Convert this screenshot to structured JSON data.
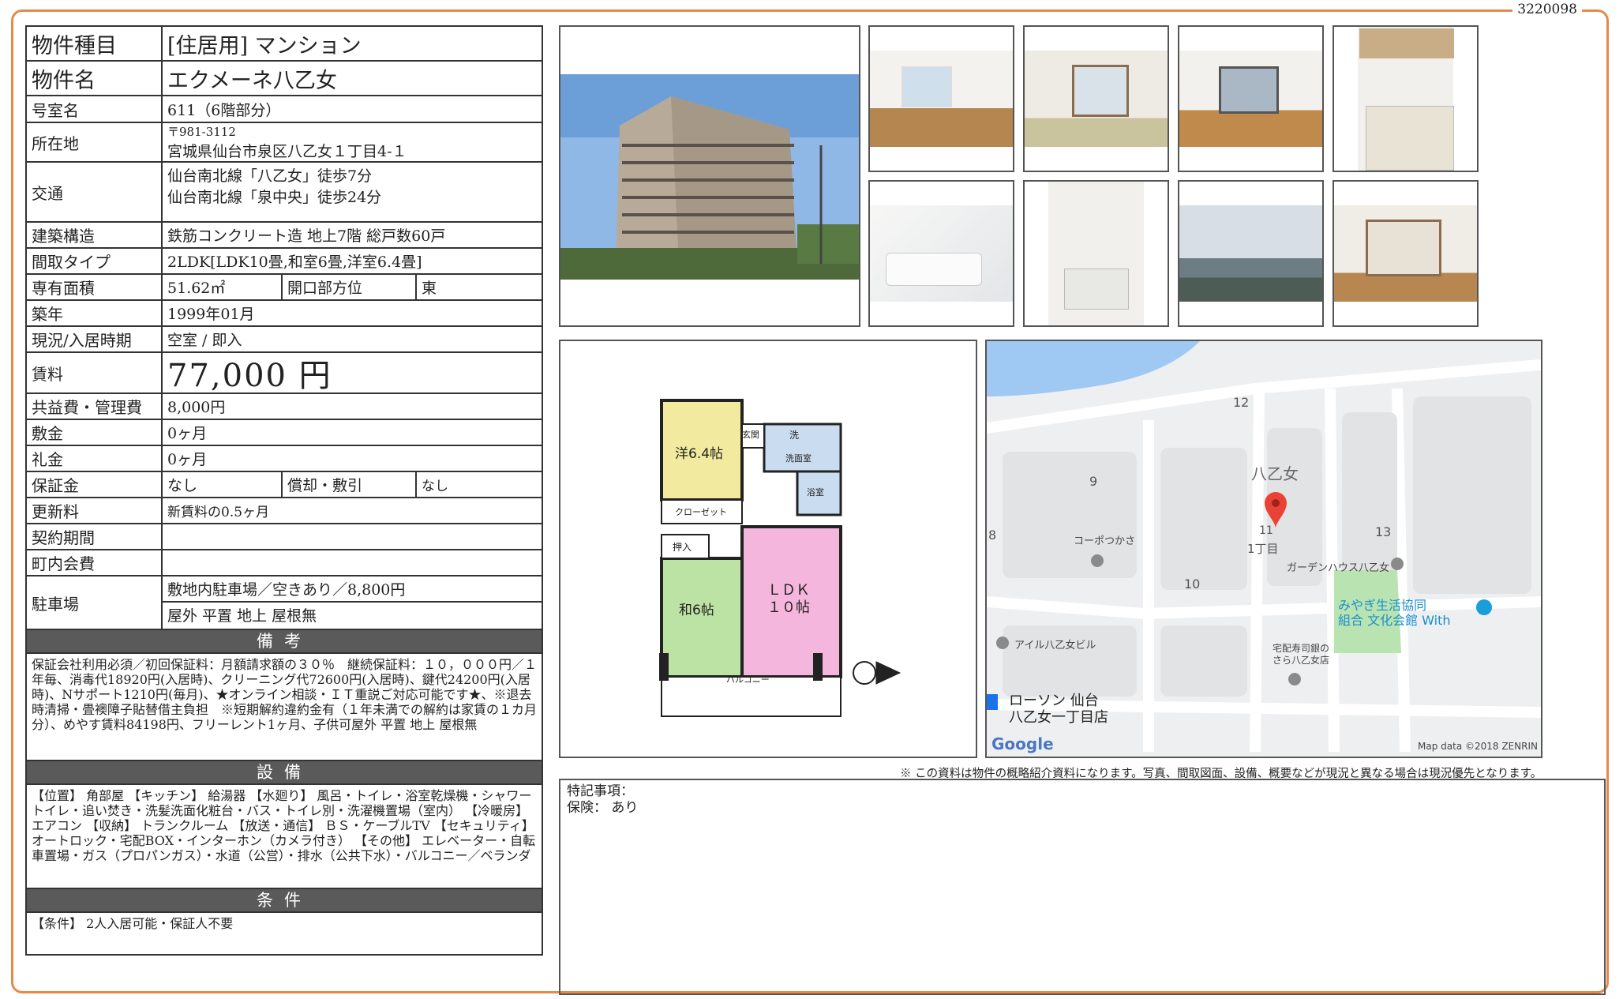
{
  "doc_id": "3220098",
  "property": {
    "type_label": "物件種目",
    "type_value": "[住居用] マンション",
    "name_label": "物件名",
    "name_value": "エクメーネ八乙女",
    "room_label": "号室名",
    "room_value": "611（6階部分）",
    "address_label": "所在地",
    "postal": "〒981-3112",
    "address": "宮城県仙台市泉区八乙女１丁目4-１",
    "access_label": "交通",
    "access_1": "仙台南北線「八乙女」徒歩7分",
    "access_2": "仙台南北線「泉中央」徒歩24分",
    "structure_label": "建築構造",
    "structure_value": "鉄筋コンクリート造 地上7階 総戸数60戸",
    "layout_label": "間取タイプ",
    "layout_value": "2LDK[LDK10畳,和室6畳,洋室6.4畳]",
    "area_label": "専有面積",
    "area_value": "51.62㎡",
    "direction_label": "開口部方位",
    "direction_value": "東",
    "built_label": "築年",
    "built_value": "1999年01月",
    "status_label": "現況/入居時期",
    "status_value": "空室 / 即入",
    "rent_label": "賃料",
    "rent_value": "77,000 円",
    "fee_label": "共益費・管理費",
    "fee_value": "8,000円",
    "deposit_label": "敷金",
    "deposit_value": "0ヶ月",
    "key_label": "礼金",
    "key_value": "0ヶ月",
    "guarantee_label": "保証金",
    "guarantee_value": "なし",
    "amort_label": "償却・敷引",
    "amort_value": "なし",
    "renewal_label": "更新料",
    "renewal_value": "新賃料の0.5ヶ月",
    "contract_label": "契約期間",
    "contract_value": "",
    "town_label": "町内会費",
    "town_value": "",
    "parking_label": "駐車場",
    "parking_1": "敷地内駐車場／空きあり／8,800円",
    "parking_2": "屋外 平置 地上 屋根無"
  },
  "sections": {
    "remarks_title": "備考",
    "remarks_text": "保証会社利用必須／初回保証料：月額請求額の３０％　継続保証料：１０，０００円／１年毎、消毒代18920円(入居時)、クリーニング代72600円(入居時)、鍵代24200円(入居時)、Nサポート1210円(毎月)、★オンライン相談・ＩＴ重説ご対応可能です★、※退去時清掃・畳襖障子貼替借主負担　※短期解約違約金有（１年未満での解約は家賃の１カ月分）、めやす賃料84198円、フリーレント1ヶ月、子供可屋外 平置 地上 屋根無",
    "equipment_title": "設備",
    "equipment_text": "【位置】 角部屋 【キッチン】 給湯器 【水廻り】 風呂・トイレ・浴室乾燥機・シャワートイレ・追い焚き・洗髪洗面化粧台・バス・トイレ別・洗濯機置場（室内） 【冷暖房】 エアコン 【収納】 トランクルーム 【放送・通信】 ＢＳ・ケーブルTV 【セキュリティ】 オートロック・宅配BOX・インターホン（カメラ付き） 【その他】 エレベーター・自転車置場・ガス（プロパンガス）・水道（公営）・排水（公共下水）・バルコニー／ベランダ",
    "conditions_title": "条件",
    "conditions_text": "【条件】 2人入居可能・保証人不要"
  },
  "floorplan": {
    "western": "洋6.4帖",
    "entrance": "玄関",
    "wash": "洗",
    "washroom": "洗面室",
    "bath": "浴室",
    "closet": "クローゼット",
    "oshiire": "押入",
    "japanese": "和6帖",
    "ldk_1": "ＬＤＫ",
    "ldk_2": "１０帖",
    "balcony": "バルコニー"
  },
  "map": {
    "area": "八乙女",
    "chome": "1丁目",
    "n12": "12",
    "n9": "9",
    "n8": "8",
    "n10": "10",
    "n13": "13",
    "n11": "11",
    "poi_1": "コーポつかさ",
    "poi_2": "ガーデンハウス八乙女",
    "poi_3": "みやぎ生活協同",
    "poi_3b": "組合 文化会館 With",
    "poi_4": "アイル八乙女ビル",
    "poi_5": "宅配寿司銀の",
    "poi_5b": "さら八乙女店",
    "poi_6": "ローソン 仙台",
    "poi_6b": "八乙女一丁目店",
    "logo": "Google",
    "credit": "Map data ©2018 ZENRIN"
  },
  "disclaimer": "※ この資料は物件の概略紹介資料になります。写真、間取図面、設備、概要などが現況と異なる場合は現況優先となります。",
  "notes": {
    "line1": "特記事項：",
    "line2": "保険： あり"
  }
}
